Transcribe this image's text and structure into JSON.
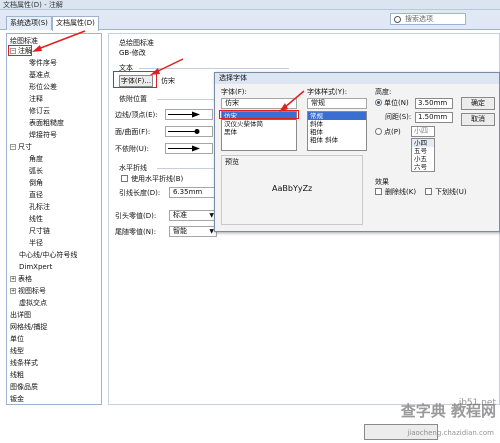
{
  "window": {
    "title": "文档属性(D) - 注解"
  },
  "tabs": [
    {
      "label": "系统选项(S)"
    },
    {
      "label": "文档属性(D)"
    }
  ],
  "search": {
    "placeholder": "搜索选项"
  },
  "tree": {
    "items": [
      {
        "label": "绘图标准"
      },
      {
        "label": "注解"
      },
      {
        "label": "零件序号"
      },
      {
        "label": "基准点"
      },
      {
        "label": "形位公差"
      },
      {
        "label": "注释"
      },
      {
        "label": "修订云"
      },
      {
        "label": "表面粗糙度"
      },
      {
        "label": "焊接符号"
      },
      {
        "label": "尺寸"
      },
      {
        "label": "角度"
      },
      {
        "label": "弧长"
      },
      {
        "label": "倒角"
      },
      {
        "label": "直径"
      },
      {
        "label": "孔标注"
      },
      {
        "label": "线性"
      },
      {
        "label": "尺寸链"
      },
      {
        "label": "半径"
      },
      {
        "label": "中心线/中心符号线"
      },
      {
        "label": "DimXpert"
      },
      {
        "label": "表格"
      },
      {
        "label": "视图标号"
      },
      {
        "label": "虚拟交点"
      },
      {
        "label": "出详图"
      },
      {
        "label": "网格线/捕捉"
      },
      {
        "label": "单位"
      },
      {
        "label": "线型"
      },
      {
        "label": "线条样式"
      },
      {
        "label": "线粗"
      },
      {
        "label": "图像品质"
      },
      {
        "label": "钣金"
      }
    ]
  },
  "panel": {
    "standard_heading": "总绘图标准",
    "standard_value": "GB-修改",
    "text_heading": "文本",
    "font_button": "字体(F)...",
    "font_value": "仿宋",
    "leader_heading": "依附位置",
    "leader_rows": [
      {
        "label": "边线/顶点(E):"
      },
      {
        "label": "面/曲面(F):"
      },
      {
        "label": "不依附(U):"
      }
    ],
    "bent_heading": "水平折线",
    "bent_checkbox": "使用水平折线(B)",
    "leader_length_label": "引线长度(D):",
    "leader_length_value": "6.35mm",
    "arrow_style_label": "引头零值(D):",
    "arrow_style_value": "标准",
    "tail_label": "尾随零值(N):",
    "tail_value": "智能"
  },
  "font_dialog": {
    "title": "选择字体",
    "font_label": "字体(F):",
    "font_input": "仿宋",
    "font_list": [
      "仿宋",
      "汉仪火柴体简",
      "黑体"
    ],
    "style_label": "字体样式(Y):",
    "style_input": "常规",
    "style_list": [
      "常规",
      "斜体",
      "粗体",
      "粗体 斜体"
    ],
    "height_label": "高度:",
    "unit_radio": "单位(N)",
    "unit_value": "3.50mm",
    "spacing_label": "间距(S):",
    "spacing_value": "1.50mm",
    "points_radio": "点(P)",
    "points_input": "小四",
    "points_list": [
      "小四",
      "五号",
      "小五",
      "六号"
    ],
    "ok_button": "确定",
    "cancel_button": "取消",
    "preview_label": "预览",
    "preview_text": "AaBbYyZz",
    "effects_label": "效果",
    "strike_checkbox": "删除线(K)",
    "underline_checkbox": "下划线(U)"
  },
  "watermark": {
    "line1": "查字典 教程网",
    "line2": "jiaocheng.chazidian.com",
    "site": "ib51.net"
  },
  "colors": {
    "annotation_red": "#e02020",
    "selection_blue": "#3a6fd1",
    "titlebar": "#dbe5f1"
  }
}
